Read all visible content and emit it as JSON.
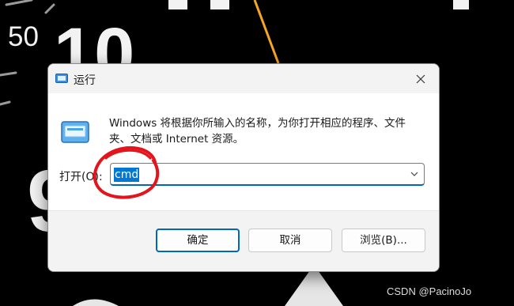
{
  "background": {
    "speed_label": "50",
    "large_number": "10",
    "large_digit": "9",
    "needle_color": "#f5a623"
  },
  "dialog": {
    "title": "运行",
    "title_icon": "run-icon",
    "close_icon": "close-icon",
    "app_icon": "run-program-icon",
    "description": "Windows 将根据你所输入的名称，为你打开相应的程序、文件夹、文档或 Internet 资源。",
    "open_label": "打开(O):",
    "input_value": "cmd",
    "dropdown_icon": "chevron-down-icon",
    "buttons": {
      "ok": "确定",
      "cancel": "取消",
      "browse": "浏览(B)..."
    },
    "accent_color": "#0067c0",
    "selection_color": "#0078d4"
  },
  "annotation": {
    "shape": "red-hand-drawn-circle",
    "color": "#e3141b",
    "target": "input"
  },
  "watermark": "CSDN @PacinoJo"
}
